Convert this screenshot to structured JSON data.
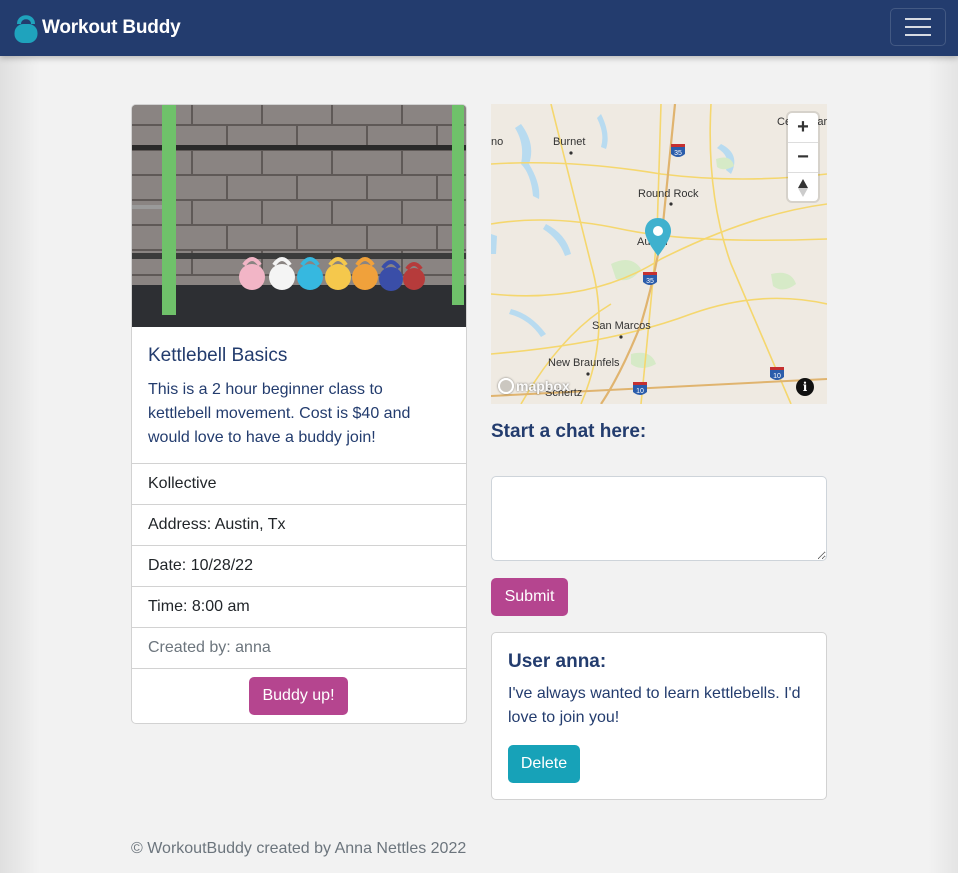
{
  "navbar": {
    "brand": "Workout Buddy",
    "brand_icon": "kettlebell-icon",
    "menu_icon": "hamburger-icon",
    "bg_color": "#233c6e"
  },
  "event": {
    "image_icon": "kettlebell-gym-photo",
    "title": "Kettlebell Basics",
    "description": "This is a 2 hour beginner class to kettlebell movement. Cost is $40 and would love to have a buddy join!",
    "location": "Kollective",
    "address": "Address: Austin, Tx",
    "date": "Date: 10/28/22",
    "time": "Time: 8:00 am",
    "created_by": "Created by: anna",
    "buddy_button": "Buddy up!"
  },
  "map": {
    "labels": {
      "burnet": "Burnet",
      "round_rock": "Round Rock",
      "austin": "Austin",
      "san_marcos": "San Marcos",
      "new_braunfels": "New Braunfels",
      "cedar_park": "Cedar Park",
      "no": "no",
      "schertz": "Schertz"
    },
    "highways": {
      "i35_north": "35",
      "i35_south": "35",
      "i10_left": "10",
      "i10_right": "10"
    },
    "zoom_in": "+",
    "zoom_out": "−",
    "logo": "mapbox",
    "info": "i"
  },
  "chat": {
    "heading": "Start a chat here:",
    "input_value": "",
    "submit_label": "Submit"
  },
  "comment": {
    "user": "User anna:",
    "text": "I've always wanted to learn kettlebells. I'd love to join you!",
    "delete_label": "Delete"
  },
  "footer": {
    "text": "© WorkoutBuddy created by Anna Nettles 2022"
  },
  "colors": {
    "accent": "#b5458f",
    "info": "#17a2b8",
    "text_primary": "#233c6e"
  }
}
